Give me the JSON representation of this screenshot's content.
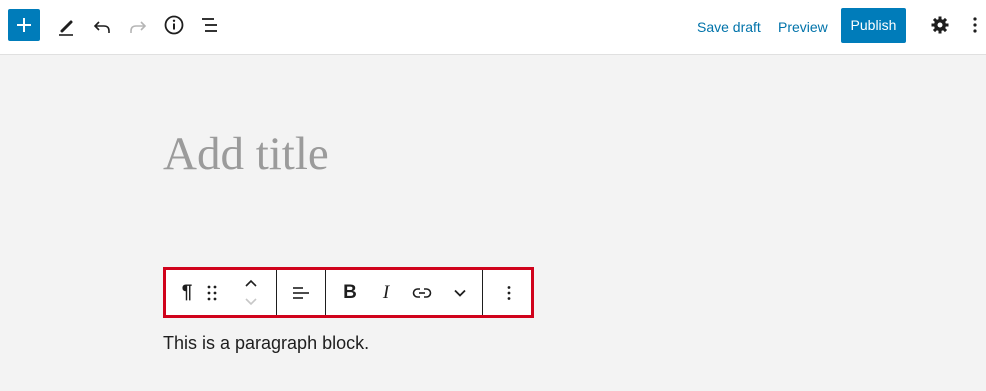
{
  "topbar": {
    "icons": {
      "add": "plus-icon",
      "tools": "pencil-icon",
      "undo": "undo-icon",
      "redo": "redo-icon",
      "details": "info-icon",
      "outline": "list-view-icon",
      "settings": "gear-icon",
      "options": "more-vertical-icon"
    },
    "save_draft_label": "Save draft",
    "preview_label": "Preview",
    "publish_label": "Publish"
  },
  "editor": {
    "title_placeholder": "Add title",
    "paragraph_text": "This is a paragraph block.",
    "block_toolbar": {
      "icons": [
        "paragraph-icon",
        "drag-handle-icon",
        "move-up-icon",
        "move-down-icon",
        "align-icon",
        "bold-icon",
        "italic-icon",
        "link-icon",
        "chevron-down-icon",
        "more-vertical-icon"
      ],
      "bold_glyph": "B",
      "italic_glyph": "I",
      "paragraph_glyph": "¶"
    }
  },
  "colors": {
    "accent": "#007cba",
    "highlight_border": "#d0021b",
    "canvas_background": "#f3f3f3"
  }
}
